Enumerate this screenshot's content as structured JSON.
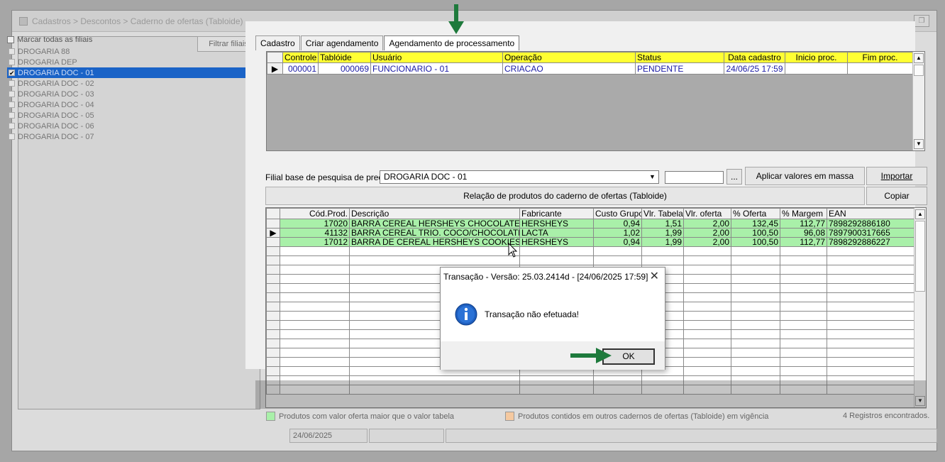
{
  "window": {
    "title": "Cadastros > Descontos > Caderno de ofertas (Tabloide)"
  },
  "left": {
    "filtrar_label": "Filtrar filiais",
    "marcar_label": "Marcar todas as filiais",
    "filiais": [
      {
        "name": "DROGARIA 88",
        "checked": false
      },
      {
        "name": "DROGARIA DEP",
        "checked": false
      },
      {
        "name": "DROGARIA DOC - 01",
        "checked": true,
        "selected": true
      },
      {
        "name": "DROGARIA DOC - 02",
        "checked": false
      },
      {
        "name": "DROGARIA DOC - 03",
        "checked": false
      },
      {
        "name": "DROGARIA DOC - 04",
        "checked": false
      },
      {
        "name": "DROGARIA DOC - 05",
        "checked": false
      },
      {
        "name": "DROGARIA DOC - 06",
        "checked": false
      },
      {
        "name": "DROGARIA DOC - 07",
        "checked": false
      }
    ]
  },
  "tabs": [
    "Cadastro",
    "Criar agendamento",
    "Agendamento de processamento"
  ],
  "schedule_grid": {
    "headers": [
      "Controle",
      "Tablóide",
      "Usuário",
      "Operação",
      "Status",
      "Data cadastro",
      "Inicio proc.",
      "Fim proc."
    ],
    "rows": [
      [
        "000001",
        "000069",
        "FUNCIONARIO - 01",
        "CRIACAO",
        "PENDENTE",
        "24/06/25 17:59",
        "",
        ""
      ]
    ]
  },
  "form": {
    "filial_label": "Filial base de pesquisa de preço",
    "filial_value": "DROGARIA DOC - 01",
    "dots": "...",
    "aplicar": "Aplicar valores em massa",
    "importar": "Importar",
    "copiar": "Copiar",
    "relacao": "Relação de produtos do caderno de ofertas (Tabloide)"
  },
  "product_grid": {
    "headers": [
      "Cód.Prod.",
      "Descrição",
      "Fabricante",
      "Custo Grupo",
      "Vlr. Tabela",
      "Vlr. oferta",
      "% Oferta",
      "% Margem",
      "EAN"
    ],
    "rows": [
      [
        "17020",
        "BARRA CEREAL HERSHEYS CHOCOLATE",
        "HERSHEYS",
        "0,94",
        "1,51",
        "2,00",
        "132,45",
        "112,77",
        "7898292886180"
      ],
      [
        "41132",
        "BARRA CEREAL TRIO. COCO/CHOCOLATE",
        "LACTA",
        "1,02",
        "1,99",
        "2,00",
        "100,50",
        "96,08",
        "7897900317665"
      ],
      [
        "17012",
        "BARRA DE CEREAL HERSHEYS COOKIESN CREAM",
        "HERSHEYS",
        "0,94",
        "1,99",
        "2,00",
        "100,50",
        "112,77",
        "7898292886227"
      ]
    ]
  },
  "legend": {
    "green_label": "Produtos com valor oferta maior que o valor tabela",
    "orange_label": "Produtos contidos em outros cadernos de ofertas (Tabloide) em vigência",
    "count": "4 Registros encontrados."
  },
  "status": {
    "date": "24/06/2025"
  },
  "dialog": {
    "title": "Transação - Versão: 25.03.2414d - [24/06/2025 17:59]",
    "message": "Transação não efetuada!",
    "ok": "OK"
  },
  "colors": {
    "accent_green": "#1e7a3c",
    "grid_header": "#ffff33",
    "row_green": "#a9f0a9",
    "selection": "#1a63c7"
  }
}
